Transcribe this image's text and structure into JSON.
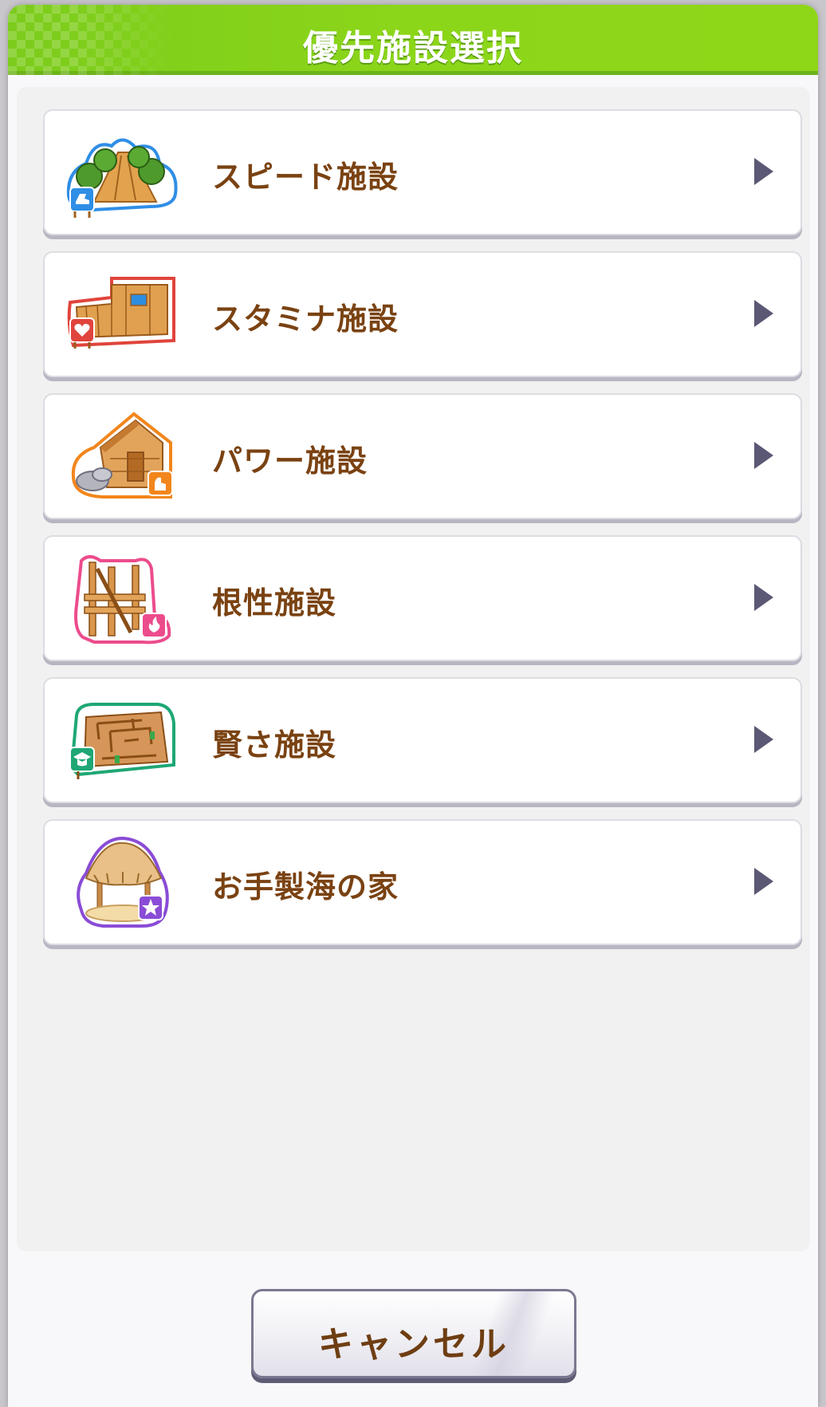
{
  "dialog": {
    "title": "優先施設選択"
  },
  "items": [
    {
      "label": "スピード施設",
      "icon": "speed-facility-icon",
      "accent": "#2f8ee6"
    },
    {
      "label": "スタミナ施設",
      "icon": "stamina-facility-icon",
      "accent": "#e0443c"
    },
    {
      "label": "パワー施設",
      "icon": "power-facility-icon",
      "accent": "#f2861c"
    },
    {
      "label": "根性施設",
      "icon": "guts-facility-icon",
      "accent": "#ec4c8c"
    },
    {
      "label": "賢さ施設",
      "icon": "wisdom-facility-icon",
      "accent": "#1ea774"
    },
    {
      "label": "お手製海の家",
      "icon": "beach-house-icon",
      "accent": "#8a4cd6"
    }
  ],
  "cancel": {
    "label": "キャンセル"
  },
  "colors": {
    "header": "#8cd61a",
    "label_text": "#7a4212",
    "arrow": "#5a5874"
  }
}
